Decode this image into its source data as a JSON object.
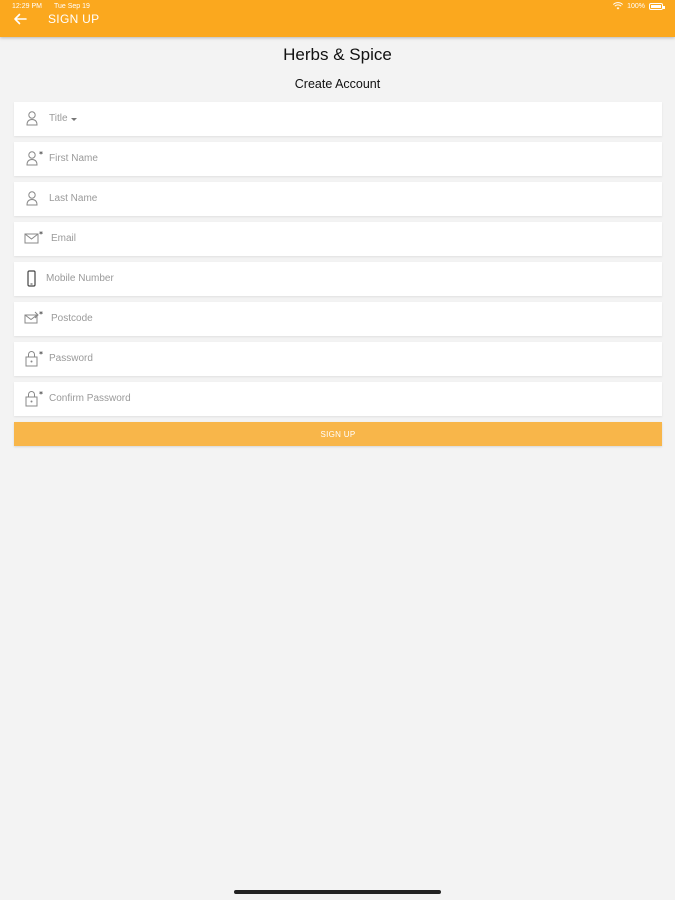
{
  "status_bar": {
    "time": "12:29 PM",
    "date": "Tue Sep 19",
    "battery": "100%"
  },
  "appbar": {
    "title": "SIGN UP"
  },
  "brand": "Herbs & Spice",
  "subtitle": "Create Account",
  "fields": [
    {
      "label": "Title",
      "icon": "person-icon",
      "required": false
    },
    {
      "label": "First Name",
      "icon": "person-required-icon",
      "required": true
    },
    {
      "label": "Last Name",
      "icon": "person-icon",
      "required": false
    },
    {
      "label": "Email",
      "icon": "email-required-icon",
      "required": true
    },
    {
      "label": "Mobile Number",
      "icon": "phone-icon",
      "required": false
    },
    {
      "label": "Postcode",
      "icon": "postcode-required-icon",
      "required": true
    },
    {
      "label": "Password",
      "icon": "lock-required-icon",
      "required": true
    },
    {
      "label": "Confirm Password",
      "icon": "lock-required-icon",
      "required": true
    }
  ],
  "signup_button": "SIGN UP",
  "colors": {
    "accent": "#fba81e",
    "button": "#f8b64a",
    "background": "#f3f3f3"
  }
}
